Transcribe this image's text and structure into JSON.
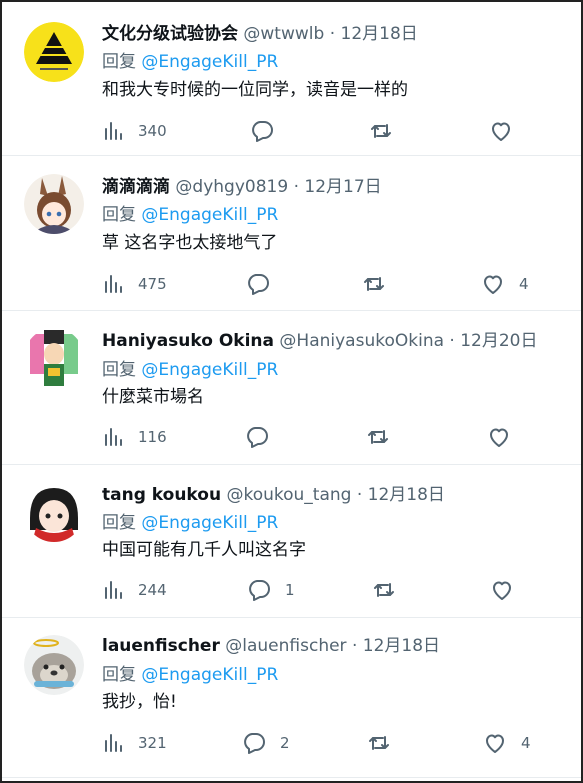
{
  "reply_prefix": "回复",
  "tweets": [
    {
      "name": "文化分级试验协会",
      "handle": "@wtwwlb",
      "sep": "·",
      "date": "12月18日",
      "mention": "@EngageKill_PR",
      "text": "和我大专时候的一位同学，读音是一样的",
      "views": "340",
      "replies": "",
      "retweets": "",
      "likes": ""
    },
    {
      "name": "滴滴滴滴",
      "handle": "@dyhgy0819",
      "sep": "·",
      "date": "12月17日",
      "mention": "@EngageKill_PR",
      "text": "草 这名字也太接地气了",
      "views": "475",
      "replies": "",
      "retweets": "",
      "likes": "4"
    },
    {
      "name": "Haniyasuko Okina",
      "handle": "@HaniyasukoOkina",
      "sep": "·",
      "date": "12月20日",
      "mention": "@EngageKill_PR",
      "text": "什麼菜市場名",
      "views": "116",
      "replies": "",
      "retweets": "",
      "likes": ""
    },
    {
      "name": "tang koukou",
      "handle": "@koukou_tang",
      "sep": "·",
      "date": "12月18日",
      "mention": "@EngageKill_PR",
      "text": "中国可能有几千人叫这名字",
      "views": "244",
      "replies": "1",
      "retweets": "",
      "likes": ""
    },
    {
      "name": "lauenfischer",
      "handle": "@lauenfischer",
      "sep": "·",
      "date": "12月18日",
      "mention": "@EngageKill_PR",
      "text": "我抄，怡!",
      "views": "321",
      "replies": "2",
      "retweets": "",
      "likes": "4"
    }
  ],
  "icons": {
    "views": "bar-chart-icon",
    "reply": "speech-bubble-icon",
    "retweet": "retweet-icon",
    "like": "heart-icon"
  },
  "colors": {
    "text": "#0f1419",
    "secondary": "#536471",
    "link": "#1d9bf0",
    "divider": "#e8ecef"
  }
}
